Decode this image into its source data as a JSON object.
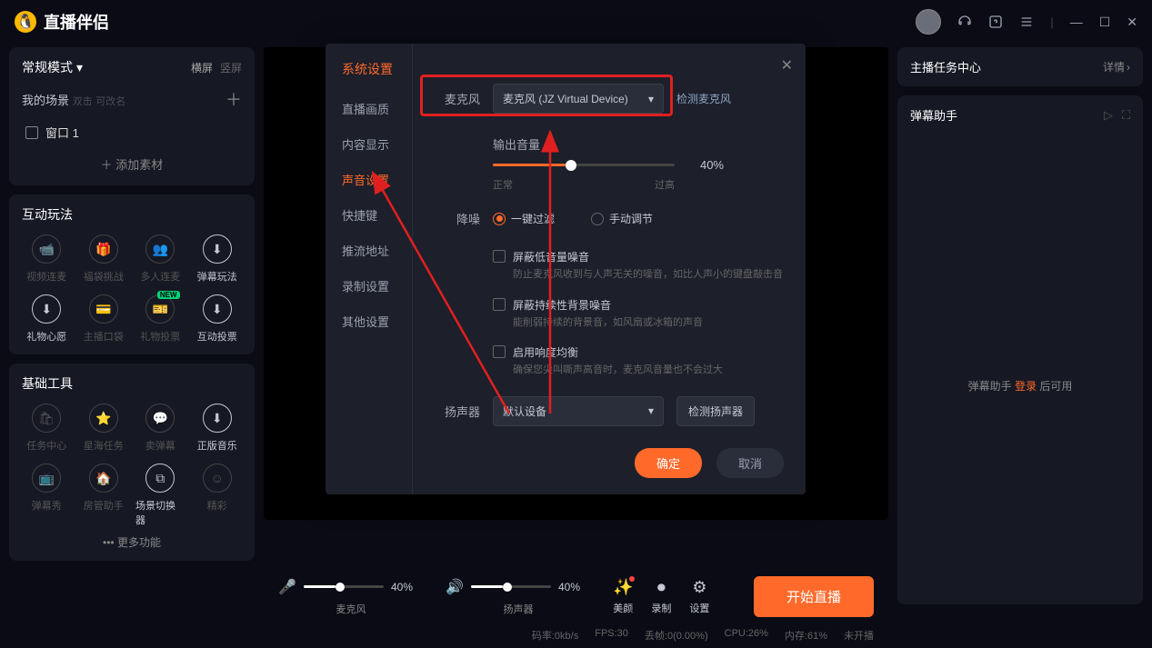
{
  "topbar": {
    "logo_text": "直播伴侣"
  },
  "left": {
    "mode_label": "常规模式",
    "orient_h": "横屏",
    "orient_v": "竖屏",
    "scene_label": "我的场景",
    "scene_hint1": "双击",
    "scene_hint2": "可改名",
    "scene_item": "窗口 1",
    "add_source": "添加素材",
    "section_interactive": "互动玩法",
    "grid_interactive": [
      {
        "label": "视频连麦",
        "enabled": false
      },
      {
        "label": "福袋挑战",
        "enabled": false
      },
      {
        "label": "多人连麦",
        "enabled": false
      },
      {
        "label": "弹幕玩法",
        "enabled": true
      },
      {
        "label": "礼物心愿",
        "enabled": true
      },
      {
        "label": "主播口袋",
        "enabled": false
      },
      {
        "label": "礼物投票",
        "enabled": false,
        "new": true
      },
      {
        "label": "互动投票",
        "enabled": true
      }
    ],
    "section_tools": "基础工具",
    "grid_tools": [
      {
        "label": "任务中心",
        "enabled": false
      },
      {
        "label": "星海任务",
        "enabled": false
      },
      {
        "label": "卖弹幕",
        "enabled": false
      },
      {
        "label": "正版音乐",
        "enabled": true
      },
      {
        "label": "弹幕秀",
        "enabled": false
      },
      {
        "label": "房管助手",
        "enabled": false
      },
      {
        "label": "场景切换器",
        "enabled": true
      },
      {
        "label": "精彩",
        "enabled": false
      }
    ],
    "more": "更多功能"
  },
  "center": {
    "mic_label": "麦克风",
    "mic_pct": "40%",
    "speaker_label": "扬声器",
    "speaker_pct": "40%",
    "ctl_beauty": "美颜",
    "ctl_record": "录制",
    "ctl_settings": "设置",
    "start_btn": "开始直播",
    "status": {
      "bitrate": "码率:0kb/s",
      "fps": "FPS:30",
      "drop": "丢帧:0(0.00%)",
      "cpu": "CPU:26%",
      "mem": "内存:61%",
      "state": "未开播"
    }
  },
  "right": {
    "task_title": "主播任务中心",
    "detail": "详情",
    "danmu_title": "弹幕助手",
    "login_pre": "弹幕助手",
    "login_link": "登录",
    "login_post": "后可用"
  },
  "modal": {
    "title": "系统设置",
    "tabs": [
      "直播画质",
      "内容显示",
      "声音设置",
      "快捷键",
      "推流地址",
      "录制设置",
      "其他设置"
    ],
    "active_tab": 2,
    "mic_label": "麦克风",
    "mic_device": "麦克风 (JZ Virtual Device)",
    "detect_mic": "检测麦克风",
    "output_volume": "输出音量",
    "volume_pct": "40%",
    "range_ok": "正常",
    "range_high": "过高",
    "noise_label": "降噪",
    "noise_auto": "一键过滤",
    "noise_manual": "手动调节",
    "checks": [
      {
        "label": "屏蔽低音量噪音",
        "desc": "防止麦克风收到与人声无关的噪音，如比人声小的键盘敲击音"
      },
      {
        "label": "屏蔽持续性背景噪音",
        "desc": "能削弱持续的背景音，如风扇或冰箱的声音"
      },
      {
        "label": "启用响度均衡",
        "desc": "确保您尖叫嘶声高音时，麦克风音量也不会过大"
      }
    ],
    "speaker_label": "扬声器",
    "speaker_device": "默认设备",
    "detect_speaker": "检测扬声器",
    "ok_btn": "确定",
    "cancel_btn": "取消"
  }
}
